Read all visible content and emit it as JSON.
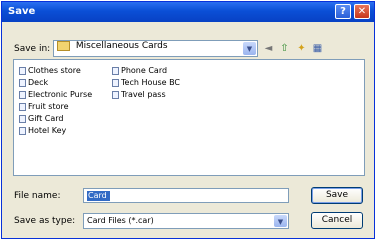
{
  "window": {
    "title": "Save"
  },
  "titlebar": {
    "help": "?",
    "close": "✕"
  },
  "header": {
    "save_in_label": "Save in:",
    "save_in_value": "Miscellaneous Cards",
    "toolbar_glyphs": {
      "back": "◄",
      "up": "⇧",
      "new_folder": "✦",
      "views": "▦"
    }
  },
  "files": [
    "Clothes store",
    "Deck",
    "Electronic Purse",
    "Fruit store",
    "Gift Card",
    "Hotel Key",
    "Phone Card",
    "Tech House BC",
    "Travel pass"
  ],
  "footer": {
    "file_name_label": "File name:",
    "file_name_value": "Card",
    "save_as_type_label": "Save as type:",
    "save_as_type_value": "Card Files (*.car)",
    "save_button": "Save",
    "cancel_button": "Cancel"
  }
}
